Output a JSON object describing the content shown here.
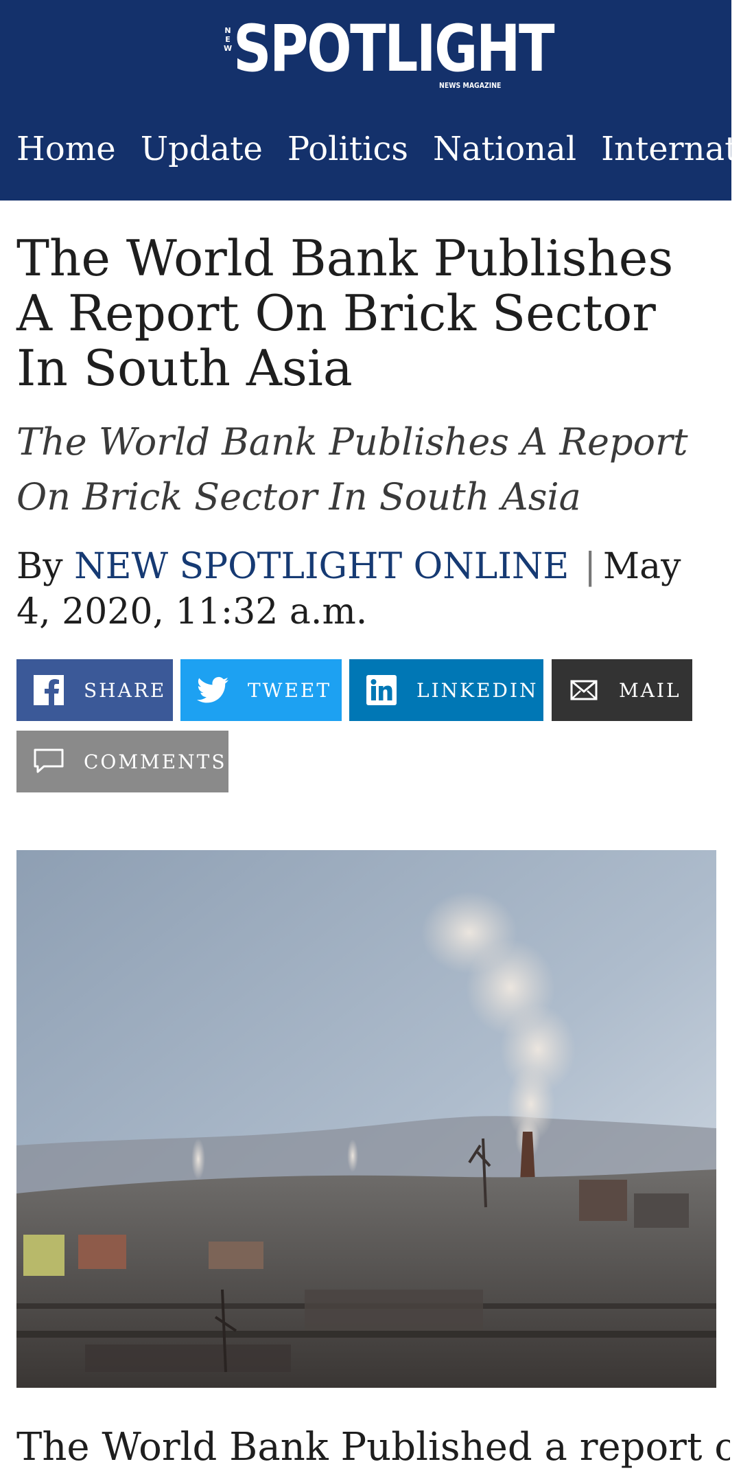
{
  "header": {
    "logo": {
      "new_text": "NEW",
      "name": "SPOTLIGHT",
      "tagline": "NEWS MAGAZINE"
    },
    "nav": [
      "Home",
      "Update",
      "Politics",
      "National",
      "International"
    ]
  },
  "article": {
    "headline": "The World Bank Publishes A Report On Brick Sector In South Asia",
    "subheadline": "The World Bank Publishes A Report On Brick Sector In South Asia",
    "by_label": "By",
    "author": "NEW SPOTLIGHT ONLINE",
    "separator": "|",
    "date": "May 4, 2020, 11:32 a.m.",
    "body_start": "The World Bank Published a report on"
  },
  "share": {
    "share_label": "SHARE",
    "tweet_label": "TWEET",
    "linkedin_label": "LINKEDIN",
    "mail_label": "MAIL",
    "comments_label": "COMMENTS"
  },
  "colors": {
    "header_bg": "#14316b",
    "author_link": "#163a73",
    "facebook": "#3b5998",
    "twitter": "#1da1f2",
    "linkedin": "#0077b5",
    "mail": "#333333",
    "comments": "#8a8a8a"
  }
}
